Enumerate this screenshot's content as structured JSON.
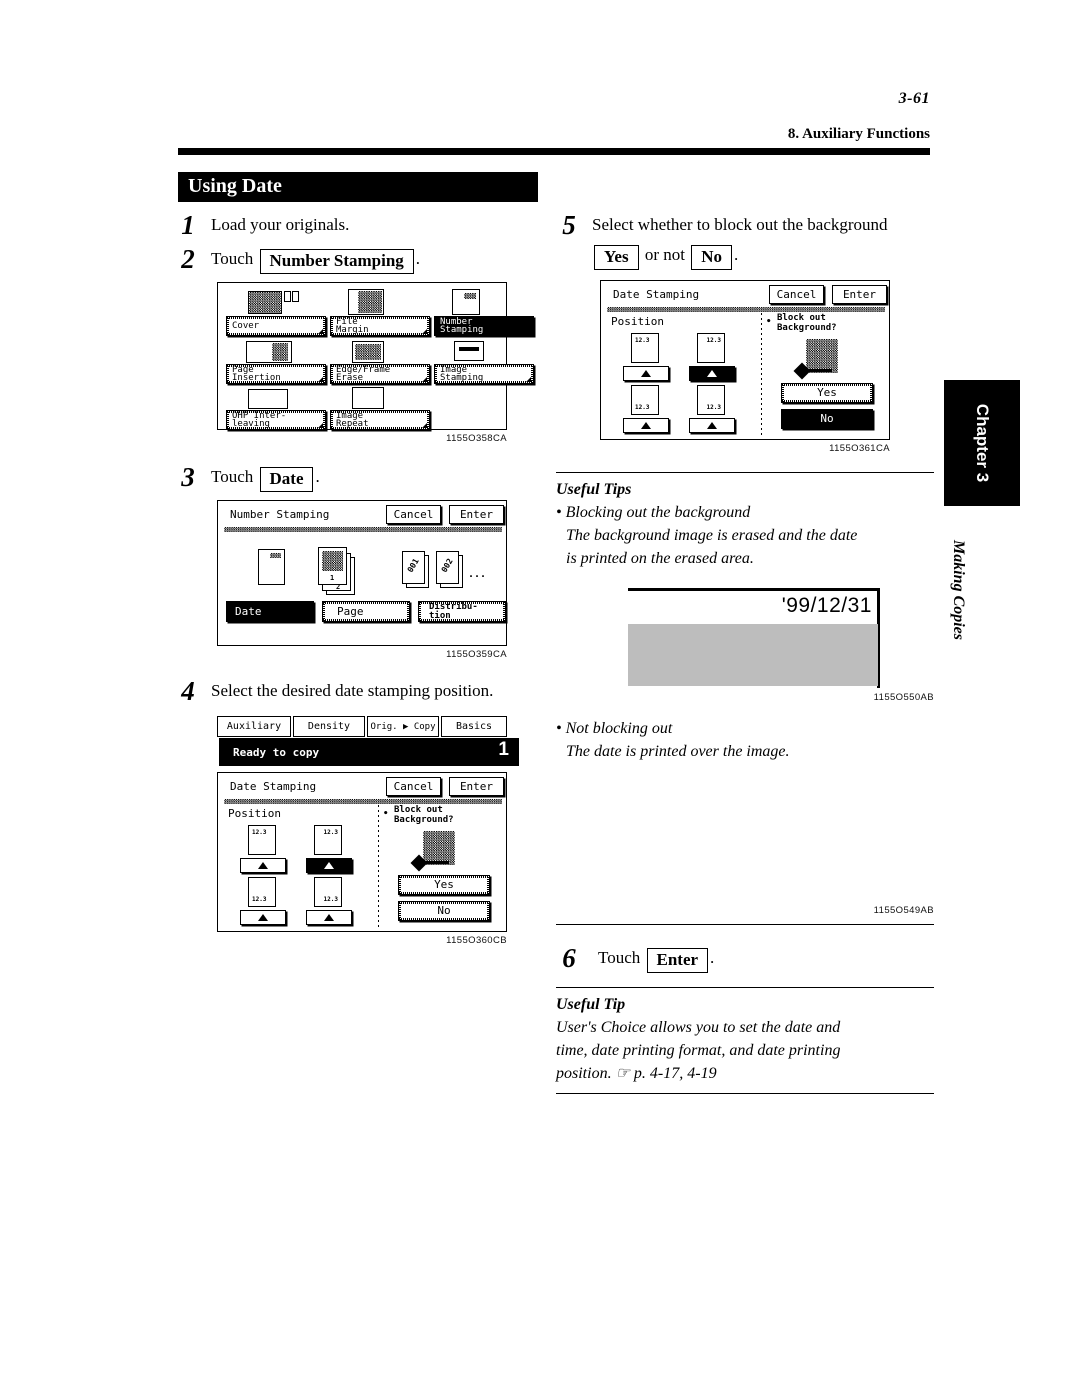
{
  "header": {
    "folio": "3-61",
    "running_head": "8. Auxiliary Functions"
  },
  "section": {
    "title": "Using Date"
  },
  "chapter_tab": {
    "label": "Chapter 3",
    "part_label": "Making Copies"
  },
  "steps": {
    "s1": {
      "num": "1",
      "text": "Load your originals."
    },
    "s2": {
      "num": "2",
      "lead": "Touch",
      "key": "Number Stamping",
      "tail": "."
    },
    "s3": {
      "num": "3",
      "lead": "Touch",
      "key": "Date",
      "tail": "."
    },
    "s4": {
      "num": "4",
      "text": "Select the desired date stamping position."
    },
    "s5": {
      "num": "5",
      "line1": "Select whether to block out the background",
      "key_yes": "Yes",
      "mid": "or not",
      "key_no": "No",
      "tail": "."
    },
    "s6": {
      "num": "6",
      "lead": "Touch",
      "key": "Enter",
      "tail": "."
    }
  },
  "figures": {
    "auxiliary_menu": {
      "code": "1155O358CA",
      "buttons": [
        {
          "label": "Cover",
          "selected": false
        },
        {
          "label": "File\nMargin",
          "selected": false
        },
        {
          "label": "Number\nStamping",
          "selected": true
        },
        {
          "label": "Page\nInsertion",
          "selected": false
        },
        {
          "label": "Edge/Frame\nErase",
          "selected": false
        },
        {
          "label": "Image\nStamping",
          "selected": false
        },
        {
          "label": "OHP Inter-\nleaving",
          "selected": false
        },
        {
          "label": "Image\nRepeat",
          "selected": false
        }
      ]
    },
    "number_stamping": {
      "code": "1155O359CA",
      "title": "Number Stamping",
      "cancel": "Cancel",
      "enter": "Enter",
      "icon_date_label": "12.3",
      "icon_page_labels": [
        "1",
        "2"
      ],
      "icon_distribution_labels": [
        "001",
        "002"
      ],
      "ellipsis": "...",
      "buttons": [
        {
          "label": "Date",
          "selected": true
        },
        {
          "label": "Page",
          "selected": false
        },
        {
          "label": "Distribu-\ntion",
          "selected": false
        }
      ]
    },
    "date_stamping_position": {
      "code": "1155O360CB",
      "tabs": [
        "Auxiliary",
        "Density",
        "Orig. ▶ Copy",
        "Basics"
      ],
      "active_tab": "Auxiliary",
      "message": "Ready to copy",
      "count": "1",
      "title": "Date Stamping",
      "cancel": "Cancel",
      "enter": "Enter",
      "position_label": "Position",
      "page_marks": [
        "12.3",
        "12.3",
        "12.3",
        "12.3"
      ],
      "selected_position_index": 1,
      "blockout_label": "Block out\nBackground?",
      "yes": "Yes",
      "no": "No",
      "blockout_selected": ""
    },
    "date_stamping_blockout": {
      "code": "1155O361CA",
      "title": "Date Stamping",
      "cancel": "Cancel",
      "enter": "Enter",
      "position_label": "Position",
      "page_marks": [
        "12.3",
        "12.3",
        "12.3",
        "12.3"
      ],
      "selected_position_index": 1,
      "blockout_label": "Block out\nBackground?",
      "yes": "Yes",
      "no": "No",
      "blockout_selected": "No"
    },
    "sample_blocked": {
      "code": "1155O550AB",
      "date": "'99/12/31"
    },
    "sample_not_blocked": {
      "code": "1155O549AB"
    }
  },
  "tips": {
    "tips_heading": "Useful Tips",
    "bullet1_title": "• Blocking out the background",
    "bullet1_body": "The background image is erased and the date\nis printed on the erased area.",
    "bullet2_title": "• Not blocking out",
    "bullet2_body": "The date is printed over the image.",
    "tip_heading": "Useful Tip",
    "tip_body": "User's Choice allows you to set the date and\ntime, date printing format, and date printing\nposition. ☞ p. 4-17, 4-19"
  }
}
